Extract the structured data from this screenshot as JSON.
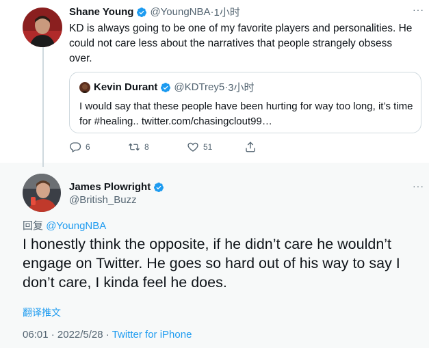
{
  "tweet": {
    "author_name": "Shane Young",
    "author_handle": "@YoungNBA",
    "separator": "·",
    "time": "1小时",
    "text": "KD is always going to be one of my favorite players and personalities. He could not care less about the narratives that people strangely obsess over.",
    "more": "···",
    "quote": {
      "author_name": "Kevin Durant",
      "author_handle": "@KDTrey5",
      "separator": "·",
      "time": "3小时",
      "text": "I would say that these people have been hurting for way too long, it’s time for #healing.. twitter.com/chasingclout99…"
    },
    "actions": {
      "replies": "6",
      "retweets": "8",
      "likes": "51"
    }
  },
  "reply": {
    "author_name": "James Plowright",
    "author_handle": "@British_Buzz",
    "more": "···",
    "replying_label": "回复",
    "replying_to": "@YoungNBA",
    "text": "I honestly think the opposite, if he didn’t care he wouldn’t engage on Twitter. He goes so hard out of his way to say I don’t care, I kinda feel he does.",
    "translate": "翻译推文",
    "time": "06:01",
    "sep1": "·",
    "date": "2022/5/28",
    "sep2": "·",
    "source": "Twitter for iPhone"
  },
  "colors": {
    "accent": "#1d9bf0",
    "text": "#0f1419",
    "muted": "#536471",
    "highlight_bg": "#f7f9f9"
  }
}
